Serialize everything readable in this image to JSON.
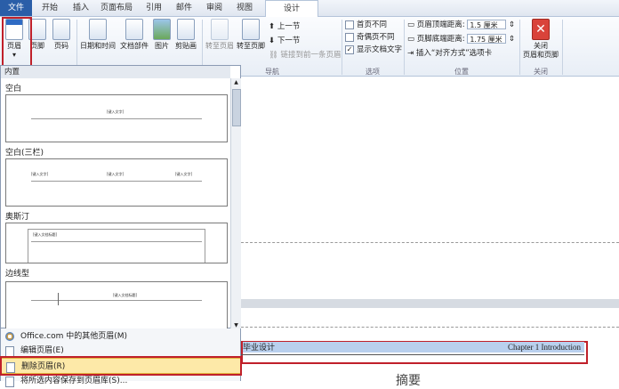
{
  "tabs": [
    {
      "label": "文件"
    },
    {
      "label": "开始"
    },
    {
      "label": "插入"
    },
    {
      "label": "页面布局"
    },
    {
      "label": "引用"
    },
    {
      "label": "邮件"
    },
    {
      "label": "审阅"
    },
    {
      "label": "视图"
    },
    {
      "label": "设计"
    }
  ],
  "ribbon": {
    "header_btn": "页眉",
    "footer_btn": "页脚",
    "pagenum_btn": "页码",
    "datetime_btn": "日期和时间",
    "docparts_btn": "文档部件",
    "picture_btn": "图片",
    "clipart_btn": "剪贴画",
    "goto_header_btn": "转至页眉",
    "goto_footer_btn": "转至页脚",
    "prev_section": "上一节",
    "next_section": "下一节",
    "link_prev": "链接到前一条页眉",
    "nav_group": "导航",
    "opt_first_page": "首页不同",
    "opt_odd_even": "奇偶页不同",
    "opt_show_text": "显示文档文字",
    "options_group": "选项",
    "header_top_label": "页眉顶端距离:",
    "header_top_value": "1.5 厘米",
    "footer_bottom_label": "页脚底端距离:",
    "footer_bottom_value": "1.75 厘米",
    "insert_align_tab": "插入“对齐方式”选项卡",
    "position_group": "位置",
    "close_btn_line1": "关闭",
    "close_btn_line2": "页眉和页脚",
    "close_group": "关闭"
  },
  "panel": {
    "section_builtin": "内置",
    "items": [
      {
        "label": "空白",
        "placeholder": "[键入文字]"
      },
      {
        "label": "空白(三栏)",
        "placeholder": "[键入文字]"
      },
      {
        "label": "奥斯汀",
        "placeholder": "[键入文档标题]"
      },
      {
        "label": "边线型",
        "placeholder": "[键入文档标题]"
      }
    ],
    "menu": [
      {
        "label": "Office.com 中的其他页眉(M)"
      },
      {
        "label": "编辑页眉(E)"
      },
      {
        "label": "删除页眉(R)"
      },
      {
        "label": "将所选内容保存到页眉库(S)..."
      }
    ]
  },
  "document": {
    "header_left": "毕业设计",
    "header_right": "Chapter 1 Introduction",
    "body_partial": "摘要"
  }
}
